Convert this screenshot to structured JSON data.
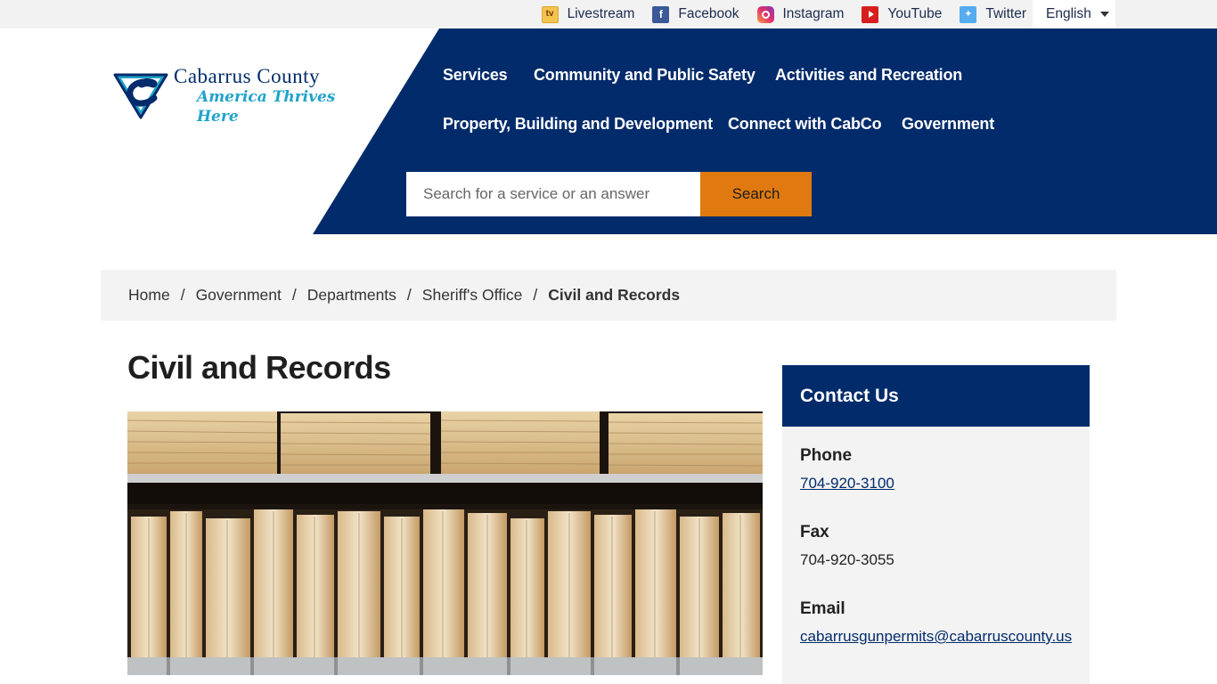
{
  "utility": {
    "social": [
      {
        "label": "Livestream",
        "icon": "tv-icon"
      },
      {
        "label": "Facebook",
        "icon": "facebook-icon"
      },
      {
        "label": "Instagram",
        "icon": "instagram-icon"
      },
      {
        "label": "YouTube",
        "icon": "youtube-icon"
      },
      {
        "label": "Twitter",
        "icon": "twitter-icon"
      }
    ],
    "language": "English"
  },
  "logo": {
    "name": "Cabarrus County",
    "tagline": "America Thrives Here",
    "colors": {
      "navy": "#022b6b",
      "teal": "#1fa3c9"
    }
  },
  "nav": {
    "items": [
      "Services",
      "Community and Public Safety",
      "Activities and Recreation",
      "Property, Building and Development",
      "Connect with CabCo",
      "Government"
    ]
  },
  "search": {
    "placeholder": "Search for a service or an answer",
    "button_label": "Search"
  },
  "breadcrumb": {
    "items": [
      "Home",
      "Government",
      "Departments",
      "Sheriff's Office"
    ],
    "separator": "/",
    "current": "Civil and Records"
  },
  "page": {
    "title": "Civil and Records"
  },
  "contact": {
    "heading": "Contact Us",
    "phone_label": "Phone",
    "phone": "704-920-3100",
    "fax_label": "Fax",
    "fax": "704-920-3055",
    "email_label": "Email",
    "email": "cabarrusgunpermits@cabarruscounty.us"
  },
  "colors": {
    "header_blue": "#022b6b",
    "search_button": "#e07a10",
    "utility_bg": "#f2f2f2",
    "breadcrumb_bg": "#f3f3f3"
  }
}
